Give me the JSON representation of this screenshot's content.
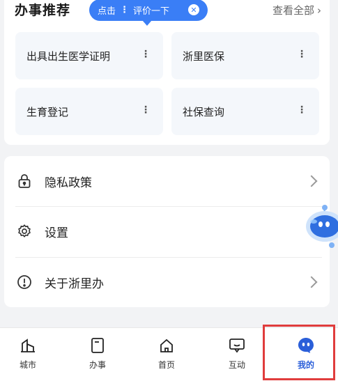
{
  "services_section": {
    "title": "办事推荐",
    "tooltip": {
      "left_text": "点击",
      "dots": "⋮",
      "right_text": "评价一下",
      "close": "✕"
    },
    "see_all": "查看全部",
    "see_all_chevron": "›",
    "items": [
      {
        "label": "出具出生医学证明",
        "more": "⋮"
      },
      {
        "label": "浙里医保",
        "more": "⋮"
      },
      {
        "label": "生育登记",
        "more": "⋮"
      },
      {
        "label": "社保查询",
        "more": "⋮"
      }
    ]
  },
  "menu": {
    "items": [
      {
        "label": "隐私政策",
        "icon": "lock-icon",
        "has_chevron": true
      },
      {
        "label": "设置",
        "icon": "gear-icon",
        "has_chevron": false
      },
      {
        "label": "关于浙里办",
        "icon": "info-icon",
        "has_chevron": true
      }
    ]
  },
  "bottom_nav": {
    "tabs": [
      {
        "label": "城市",
        "icon": "city-icon",
        "active": false
      },
      {
        "label": "办事",
        "icon": "document-icon",
        "active": false
      },
      {
        "label": "首页",
        "icon": "home-icon",
        "active": false
      },
      {
        "label": "互动",
        "icon": "chat-icon",
        "active": false
      },
      {
        "label": "我的",
        "icon": "profile-icon",
        "active": true
      }
    ]
  },
  "colors": {
    "accent": "#3a7ef6",
    "active_tab": "#2b5fd9",
    "highlight_box": "#e03c3c",
    "background": "#f2f3f5"
  }
}
